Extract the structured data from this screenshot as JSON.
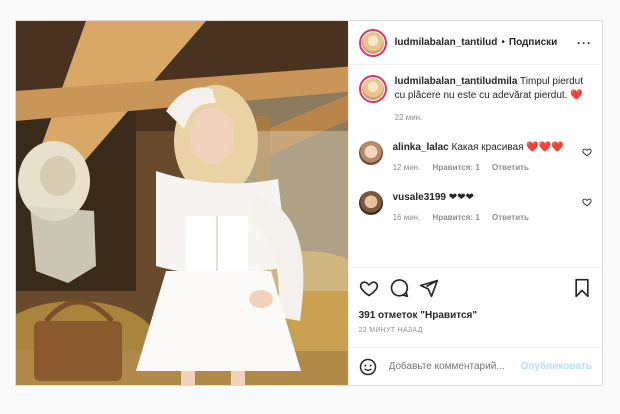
{
  "post": {
    "username": "ludmilabalan_tantilud",
    "dot": "•",
    "follow_label": "Подписки",
    "more_label": "···",
    "caption_user": "ludmilabalan_tantiludmila",
    "caption_text": "Timpul pierdut cu plăcere nu este cu adevărat pierdut. ❤️",
    "caption_time": "22 мин."
  },
  "comments": [
    {
      "user": "alinka_lalac",
      "text": "Какая красивая ❤️❤️❤️",
      "time": "12 мин.",
      "likes": "Нравится: 1",
      "reply": "Ответить"
    },
    {
      "user": "vusale3199",
      "text": "❤❤❤",
      "time": "16 мин.",
      "likes": "Нравится: 1",
      "reply": "Ответить"
    }
  ],
  "actions": {
    "likes_text": "391 отметок \"Нравится\"",
    "posted_ago": "22 МИНУТ НАЗАД"
  },
  "add_comment": {
    "placeholder": "Добавьте комментарий...",
    "publish_label": "Опубликовать"
  },
  "colors": {
    "accent": "#0095f6",
    "publish_disabled": "#b2dffc",
    "muted": "#8e8e8e",
    "border": "#dbdbdb"
  },
  "icons": [
    "heart-icon",
    "comment-icon",
    "share-icon",
    "bookmark-icon",
    "smile-icon",
    "more-icon"
  ]
}
